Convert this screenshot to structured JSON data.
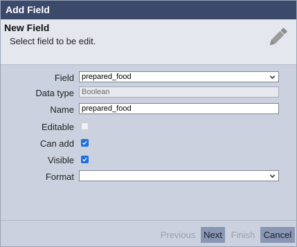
{
  "window": {
    "title": "Add Field"
  },
  "header": {
    "title": "New Field",
    "subtitle": "Select field to be edit.",
    "icon": "pencil-icon"
  },
  "form": {
    "field": {
      "label": "Field",
      "value": "prepared_food"
    },
    "data_type": {
      "label": "Data type",
      "value": "Boolean"
    },
    "name": {
      "label": "Name",
      "value": "prepared_food"
    },
    "editable": {
      "label": "Editable",
      "checked": false
    },
    "can_add": {
      "label": "Can add",
      "checked": true
    },
    "visible": {
      "label": "Visible",
      "checked": true
    },
    "format": {
      "label": "Format",
      "value": ""
    }
  },
  "footer": {
    "previous": "Previous",
    "next": "Next",
    "finish": "Finish",
    "cancel": "Cancel"
  },
  "colors": {
    "titlebar": "#3b4a6b",
    "dialog_bg": "#cbd1de",
    "header_bg": "#e4e7ee",
    "checkbox": "#1f6fe0",
    "active_button": "#8a97b4"
  }
}
